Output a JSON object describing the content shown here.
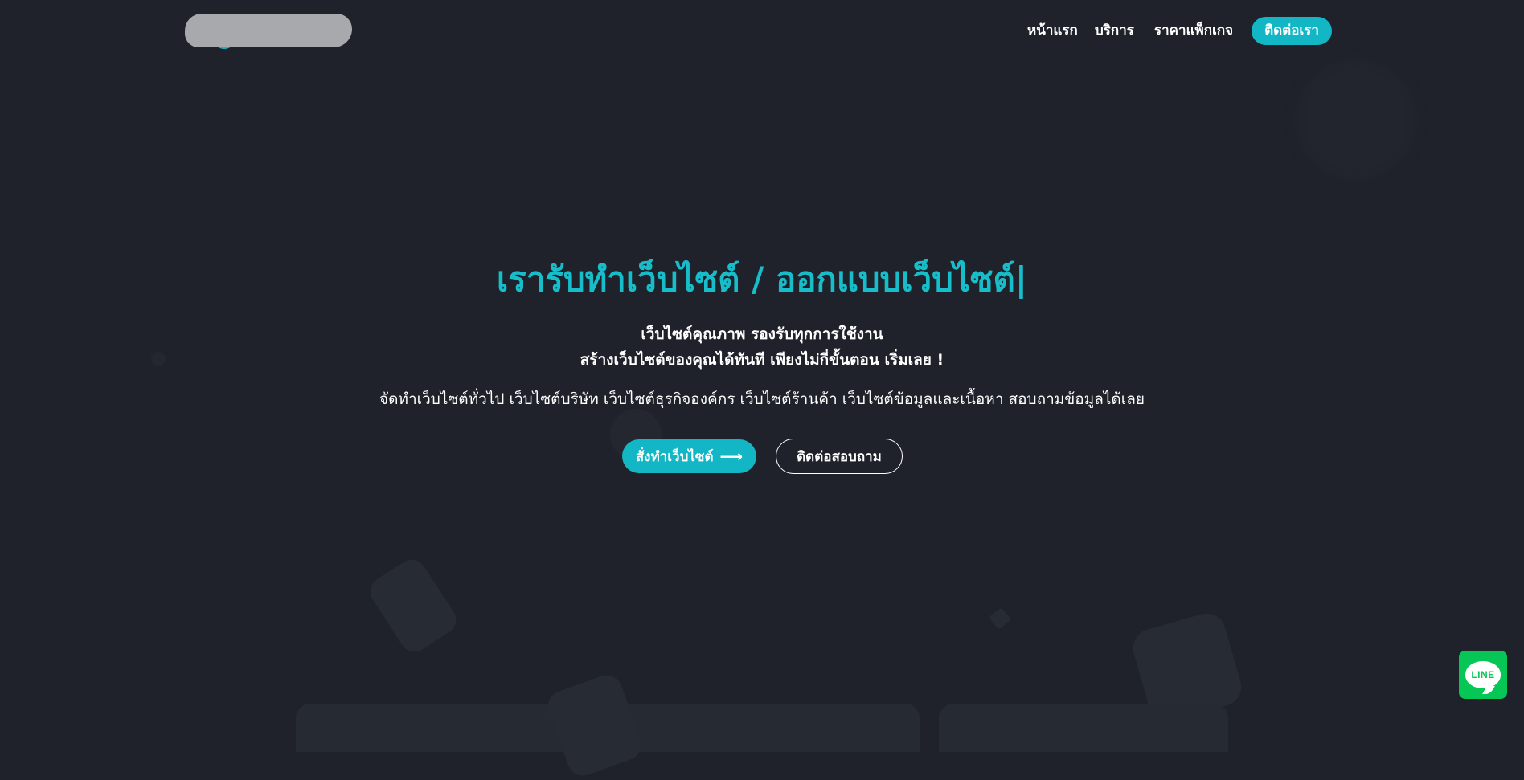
{
  "nav": {
    "items": [
      {
        "label": "หน้าแรก"
      },
      {
        "label": "บริการ"
      },
      {
        "label": "ราคาแพ็กเกจ"
      }
    ],
    "contact_label": "ติดต่อเรา"
  },
  "hero": {
    "title": "เรารับทำเว็บไซต์ / ออกแบบเว็บไซต์|",
    "subtitle_line1": "เว็บไซต์คุณภาพ รองรับทุกการใช้งาน",
    "subtitle_line2": "สร้างเว็บไซต์ของคุณได้ทันที เพียงไม่กี่ขั้นตอน เริ่มเลย !",
    "description": "จัดทำเว็บไซต์ทั่วไป เว็บไซต์บริษัท เว็บไซต์ธุรกิจองค์กร เว็บไซต์ร้านค้า เว็บไซต์ข้อมูลและเนื้อหา สอบถามข้อมูลได้เลย",
    "primary_button": "สั่งทำเว็บไซต์",
    "primary_button_icon": "arrow-right-icon",
    "secondary_button": "ติดต่อสอบถาม"
  },
  "line_widget": {
    "label": "LINE",
    "icon": "line-chat-icon"
  },
  "colors": {
    "background": "#1f222a",
    "accent": "#12b6c4",
    "line_green": "#06c755"
  }
}
